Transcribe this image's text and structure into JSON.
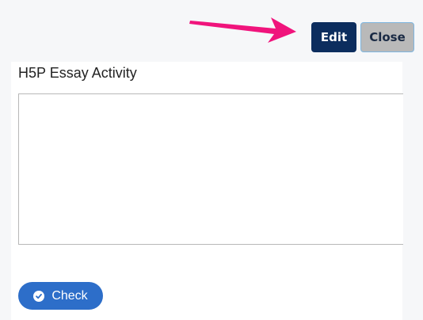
{
  "toolbar": {
    "edit_label": "Edit",
    "close_label": "Close"
  },
  "activity": {
    "title": "H5P Essay Activity",
    "essay_value": "",
    "check_label": "Check"
  },
  "annotation": {
    "arrow_icon": "pointer-arrow-icon",
    "arrow_color": "#f0147c"
  },
  "colors": {
    "edit_button": "#0c2d5e",
    "close_button": "#b9b9b9",
    "check_button": "#2d6ec9"
  }
}
